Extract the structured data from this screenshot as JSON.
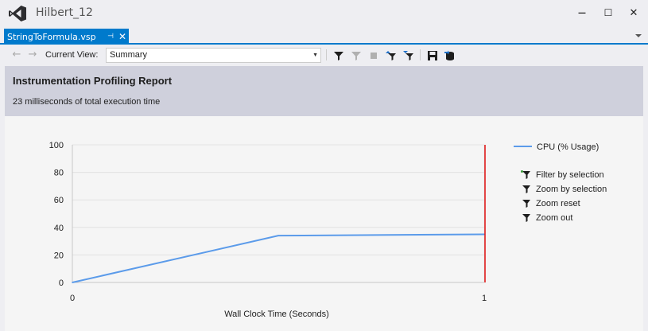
{
  "window": {
    "title": "Hilbert_12"
  },
  "tab": {
    "label": "StringToFormula.vsp",
    "pin_glyph": "⊣",
    "close_glyph": "✕"
  },
  "window_controls": {
    "minimize": "—",
    "maximize": "☐",
    "close": "✕"
  },
  "toolbar": {
    "back_glyph": "←",
    "forward_glyph": "→",
    "current_view_label": "Current View:",
    "current_view_value": "Summary",
    "icons": [
      "filter-icon",
      "filter-disabled-icon",
      "stop-icon",
      "filter-up-icon",
      "filter-down-icon",
      "save-icon",
      "export-icon"
    ]
  },
  "report": {
    "title": "Instrumentation Profiling Report",
    "subtitle": "23 milliseconds of total execution time"
  },
  "chart_data": {
    "type": "line",
    "xlabel": "Wall Clock Time (Seconds)",
    "ylabel": "",
    "xlim": [
      0,
      1
    ],
    "ylim": [
      0,
      100
    ],
    "x_ticks": [
      "0",
      "1"
    ],
    "y_ticks": [
      "0",
      "20",
      "40",
      "60",
      "80",
      "100"
    ],
    "grid": true,
    "legend_position": "right",
    "series": [
      {
        "name": "CPU (% Usage)",
        "color": "#5b9bea",
        "x": [
          0,
          0.5,
          1.0
        ],
        "y": [
          0,
          34,
          35
        ]
      }
    ],
    "marker_line": {
      "x": 1.0,
      "color": "#e01010"
    }
  },
  "chart_actions": [
    {
      "label": "Filter by selection",
      "icon": "filter-selection-icon"
    },
    {
      "label": "Zoom by selection",
      "icon": "zoom-selection-icon"
    },
    {
      "label": "Zoom reset",
      "icon": "zoom-reset-icon"
    },
    {
      "label": "Zoom out",
      "icon": "zoom-out-icon"
    }
  ]
}
